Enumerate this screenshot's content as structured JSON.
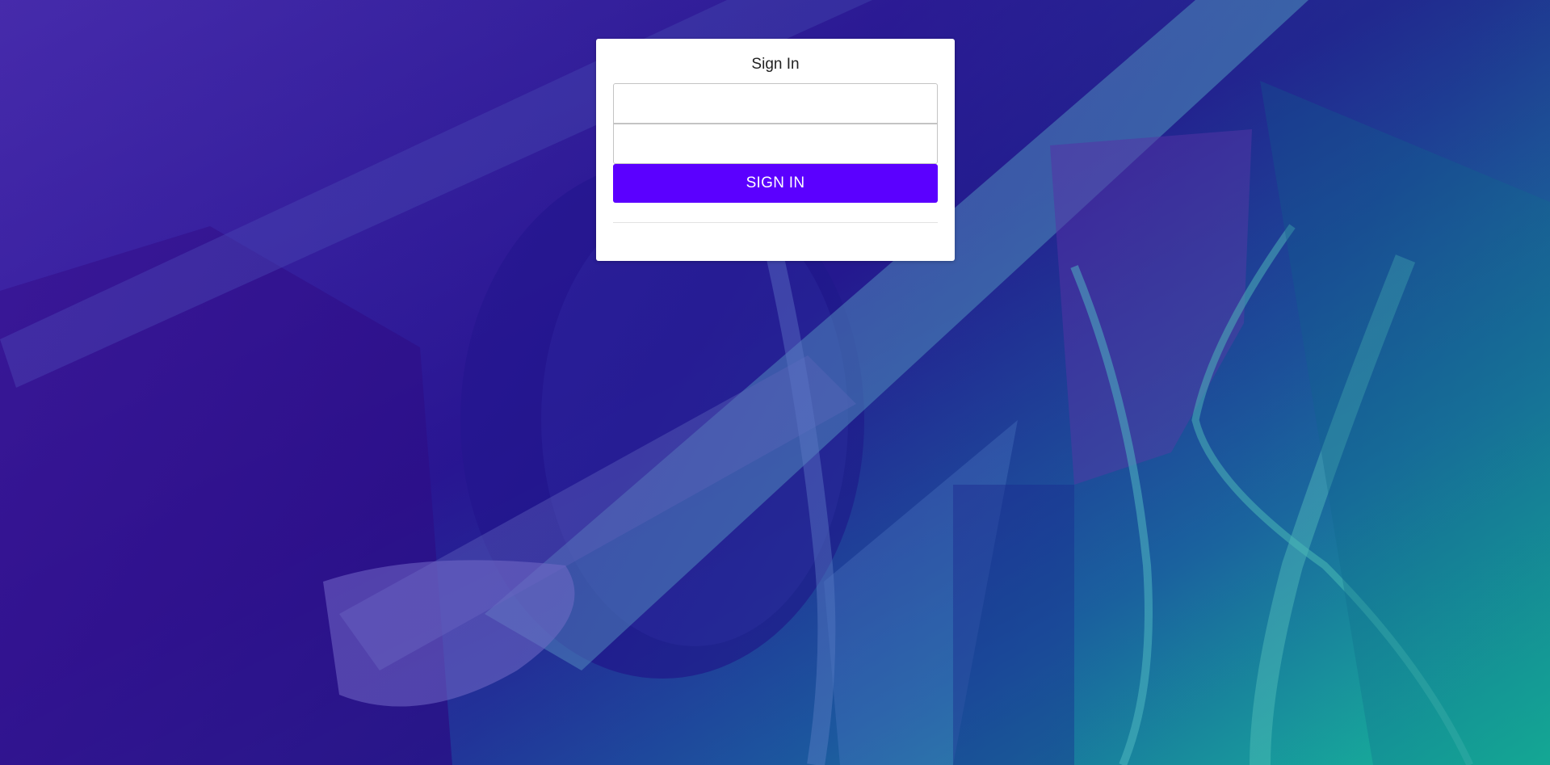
{
  "signin": {
    "title": "Sign In",
    "username_placeholder": "",
    "username_value": "",
    "password_placeholder": "",
    "password_value": "",
    "submit_label": "SIGN IN"
  },
  "colors": {
    "primary_button": "#5b00ff",
    "card_background": "#ffffff",
    "gradient_start": "#3a2f9a",
    "gradient_end": "#1aa89a"
  }
}
